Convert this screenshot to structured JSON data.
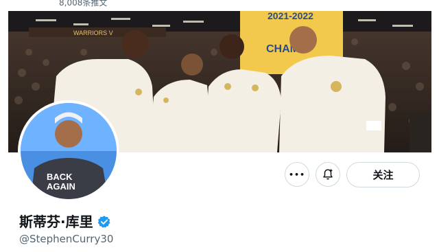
{
  "header": {
    "tweet_count": "8,008条推文"
  },
  "banner": {
    "banner_sign_year": "2021-2022",
    "banner_sign_word": "CHAMP",
    "arena_text": "WARRIORS V"
  },
  "avatar": {
    "shirt_line1": "BACK",
    "shirt_line2": "AGAIN"
  },
  "actions": {
    "more_label": "•••",
    "follow_label": "关注"
  },
  "profile": {
    "display_name": "斯蒂芬·库里",
    "handle": "@StephenCurry30"
  },
  "colors": {
    "verified_blue": "#1d9bf0",
    "banner_gold": "#f2c94c",
    "jersey_white": "#f4efe4"
  }
}
